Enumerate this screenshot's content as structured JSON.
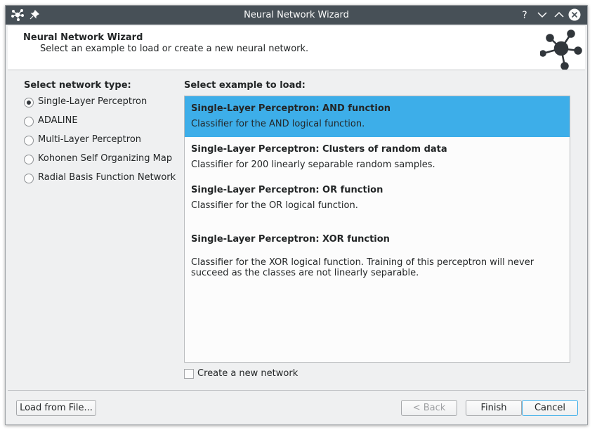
{
  "window": {
    "title": "Neural Network Wizard"
  },
  "header": {
    "title": "Neural Network Wizard",
    "subtitle": "Select an example to load or create a new neural network."
  },
  "network_type": {
    "label": "Select network type:",
    "options": [
      {
        "label": "Single-Layer Perceptron",
        "checked": true
      },
      {
        "label": "ADALINE",
        "checked": false
      },
      {
        "label": "Multi-Layer Perceptron",
        "checked": false
      },
      {
        "label": "Kohonen Self Organizing Map",
        "checked": false
      },
      {
        "label": "Radial Basis Function Network",
        "checked": false
      }
    ]
  },
  "examples": {
    "label": "Select example to load:",
    "items": [
      {
        "title": "Single-Layer Perceptron: AND function",
        "description": "Classifier for the AND logical function.",
        "selected": true
      },
      {
        "title": "Single-Layer Perceptron: Clusters of random data",
        "description": "Classifier for 200 linearly separable random samples.",
        "selected": false
      },
      {
        "title": "Single-Layer Perceptron: OR function",
        "description": "Classifier for the OR logical function.",
        "selected": false
      },
      {
        "title": "Single-Layer Perceptron: XOR function",
        "description": "Classifier for the XOR logical function. Training of this perceptron will never succeed as the classes are not linearly separable.",
        "selected": false
      }
    ]
  },
  "create_new": {
    "label": "Create a new network",
    "checked": false
  },
  "buttons": {
    "load": "Load from File...",
    "back": "< Back",
    "finish": "Finish",
    "cancel": "Cancel"
  },
  "colors": {
    "titlebar": "#475057",
    "selection": "#3daee9",
    "background": "#eff0f1"
  }
}
